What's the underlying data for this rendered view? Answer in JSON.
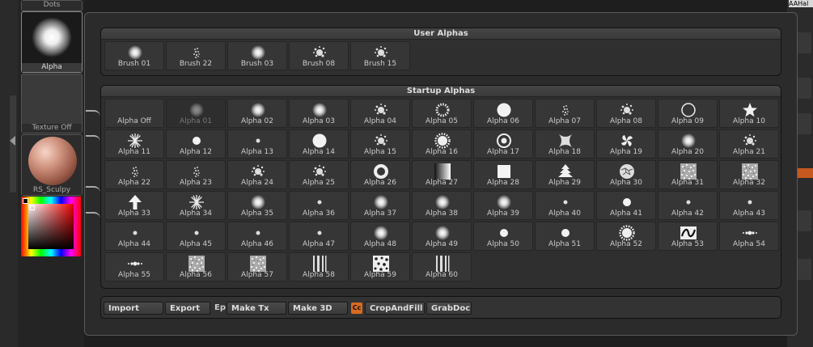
{
  "left_panel": {
    "dots_label": "Dots",
    "alpha_label": "Alpha",
    "texture_label": "Texture Off",
    "material_label": "RS_Sculpy"
  },
  "right_panel": {
    "tab_label": "AAHal"
  },
  "user_alphas": {
    "title": "User Alphas",
    "items": [
      {
        "label": "Brush 01",
        "icon": "soft-blob"
      },
      {
        "label": "Brush 22",
        "icon": "speckle-oval"
      },
      {
        "label": "Brush 03",
        "icon": "soft-blob"
      },
      {
        "label": "Brush 08",
        "icon": "splatter"
      },
      {
        "label": "Brush 15",
        "icon": "splatter"
      }
    ]
  },
  "startup_alphas": {
    "title": "Startup Alphas",
    "items": [
      {
        "label": "Alpha Off",
        "icon": "none"
      },
      {
        "label": "Alpha 01",
        "icon": "soft-blob",
        "faded": true
      },
      {
        "label": "Alpha 02",
        "icon": "soft-blob"
      },
      {
        "label": "Alpha 03",
        "icon": "soft-blob"
      },
      {
        "label": "Alpha 04",
        "icon": "splatter"
      },
      {
        "label": "Alpha 05",
        "icon": "dotted-ring"
      },
      {
        "label": "Alpha 06",
        "icon": "solid-circle"
      },
      {
        "label": "Alpha 07",
        "icon": "speckle-oval"
      },
      {
        "label": "Alpha 08",
        "icon": "splatter"
      },
      {
        "label": "Alpha 09",
        "icon": "ring"
      },
      {
        "label": "Alpha 10",
        "icon": "star"
      },
      {
        "label": "Alpha 11",
        "icon": "starburst"
      },
      {
        "label": "Alpha 12",
        "icon": "small-dot"
      },
      {
        "label": "Alpha 13",
        "icon": "tiny-dot"
      },
      {
        "label": "Alpha 14",
        "icon": "solid-circle"
      },
      {
        "label": "Alpha 15",
        "icon": "splatter"
      },
      {
        "label": "Alpha 16",
        "icon": "cog"
      },
      {
        "label": "Alpha 17",
        "icon": "target"
      },
      {
        "label": "Alpha 18",
        "icon": "pinch-square"
      },
      {
        "label": "Alpha 19",
        "icon": "swirl"
      },
      {
        "label": "Alpha 20",
        "icon": "soft-blob"
      },
      {
        "label": "Alpha 21",
        "icon": "splatter"
      },
      {
        "label": "Alpha 22",
        "icon": "speckle-oval"
      },
      {
        "label": "Alpha 23",
        "icon": "speckle-oval"
      },
      {
        "label": "Alpha 24",
        "icon": "splatter"
      },
      {
        "label": "Alpha 25",
        "icon": "splatter"
      },
      {
        "label": "Alpha 26",
        "icon": "donut"
      },
      {
        "label": "Alpha 27",
        "icon": "gradient-square"
      },
      {
        "label": "Alpha 28",
        "icon": "solid-square"
      },
      {
        "label": "Alpha 29",
        "icon": "tree"
      },
      {
        "label": "Alpha 30",
        "icon": "cobble-circle"
      },
      {
        "label": "Alpha 31",
        "icon": "noise-square"
      },
      {
        "label": "Alpha 32",
        "icon": "noise-square"
      },
      {
        "label": "Alpha 33",
        "icon": "arrow-up"
      },
      {
        "label": "Alpha 34",
        "icon": "starburst"
      },
      {
        "label": "Alpha 35",
        "icon": "soft-blob"
      },
      {
        "label": "Alpha 36",
        "icon": "tiny-dot"
      },
      {
        "label": "Alpha 37",
        "icon": "soft-blob"
      },
      {
        "label": "Alpha 38",
        "icon": "soft-blob"
      },
      {
        "label": "Alpha 39",
        "icon": "soft-blob"
      },
      {
        "label": "Alpha 40",
        "icon": "tiny-dot"
      },
      {
        "label": "Alpha 41",
        "icon": "small-dot"
      },
      {
        "label": "Alpha 42",
        "icon": "tiny-dot"
      },
      {
        "label": "Alpha 43",
        "icon": "tiny-dot"
      },
      {
        "label": "Alpha 44",
        "icon": "tiny-dot"
      },
      {
        "label": "Alpha 45",
        "icon": "tiny-dot"
      },
      {
        "label": "Alpha 46",
        "icon": "tiny-dot"
      },
      {
        "label": "Alpha 47",
        "icon": "tiny-dot"
      },
      {
        "label": "Alpha 48",
        "icon": "soft-blob"
      },
      {
        "label": "Alpha 49",
        "icon": "soft-blob"
      },
      {
        "label": "Alpha 50",
        "icon": "small-dot"
      },
      {
        "label": "Alpha 51",
        "icon": "small-dot"
      },
      {
        "label": "Alpha 52",
        "icon": "cog"
      },
      {
        "label": "Alpha 53",
        "icon": "ornament"
      },
      {
        "label": "Alpha 54",
        "icon": "dot-row"
      },
      {
        "label": "Alpha 55",
        "icon": "dot-row"
      },
      {
        "label": "Alpha 56",
        "icon": "noise-square"
      },
      {
        "label": "Alpha 57",
        "icon": "noise-square"
      },
      {
        "label": "Alpha 58",
        "icon": "stripes"
      },
      {
        "label": "Alpha 59",
        "icon": "cobble-square"
      },
      {
        "label": "Alpha 60",
        "icon": "stripes"
      }
    ]
  },
  "toolbar": {
    "import_label": "Import",
    "export_label": "Export",
    "ep_label": "Ep",
    "make_tx_label": "Make Tx",
    "make_3d_label": "Make 3D",
    "cc_label": "Cc",
    "crop_label": "CropAndFill",
    "grabdoc_label": "GrabDoc"
  },
  "colors": {
    "accent": "#d86a1e",
    "panel": "#2b2b2b",
    "cell": "#363636"
  }
}
